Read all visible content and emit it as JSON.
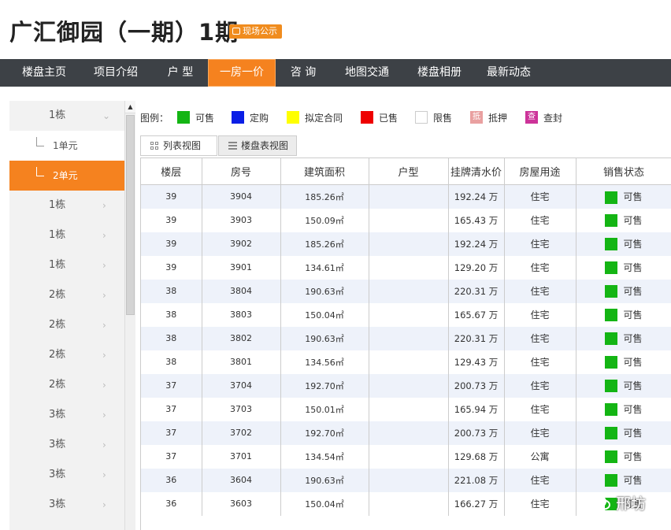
{
  "header": {
    "title": "广汇御园（一期）1期",
    "badge": "现场公示"
  },
  "nav": {
    "items": [
      {
        "label": "楼盘主页"
      },
      {
        "label": "项目介绍"
      },
      {
        "label": "户 型"
      },
      {
        "label": "一房一价",
        "active": true
      },
      {
        "label": "咨 询"
      },
      {
        "label": "地图交通"
      },
      {
        "label": "楼盘相册"
      },
      {
        "label": "最新动态"
      }
    ]
  },
  "sidebar": {
    "items": [
      {
        "label": "1栋",
        "type": "building",
        "expanded": true
      },
      {
        "label": "1单元",
        "type": "unit"
      },
      {
        "label": "2单元",
        "type": "unit",
        "active": true
      },
      {
        "label": "1栋",
        "type": "building"
      },
      {
        "label": "1栋",
        "type": "building"
      },
      {
        "label": "1栋",
        "type": "building"
      },
      {
        "label": "2栋",
        "type": "building"
      },
      {
        "label": "2栋",
        "type": "building"
      },
      {
        "label": "2栋",
        "type": "building"
      },
      {
        "label": "2栋",
        "type": "building"
      },
      {
        "label": "3栋",
        "type": "building"
      },
      {
        "label": "3栋",
        "type": "building"
      },
      {
        "label": "3栋",
        "type": "building"
      },
      {
        "label": "3栋",
        "type": "building"
      }
    ]
  },
  "legend": {
    "label": "图例：",
    "items": [
      {
        "label": "可售",
        "color": "#14b514"
      },
      {
        "label": "定购",
        "color": "#0a1ee6"
      },
      {
        "label": "拟定合同",
        "color": "#ffff00"
      },
      {
        "label": "已售",
        "color": "#ee0000"
      },
      {
        "label": "限售",
        "color": "#ffffff"
      },
      {
        "label": "抵押",
        "color": "#e9a0a0",
        "glyph": "抵"
      },
      {
        "label": "查封",
        "color": "#cc3399",
        "glyph": "查"
      }
    ]
  },
  "view_tabs": {
    "list": "列表视图",
    "table": "楼盘表视图"
  },
  "table": {
    "headers": [
      "楼层",
      "房号",
      "建筑面积",
      "户型",
      "挂牌清水价",
      "房屋用途",
      "销售状态"
    ],
    "rows": [
      {
        "floor": "39",
        "room": "3904",
        "area": "185.26㎡",
        "type": "",
        "price": "192.24 万",
        "use": "住宅",
        "status": "可售"
      },
      {
        "floor": "39",
        "room": "3903",
        "area": "150.09㎡",
        "type": "",
        "price": "165.43 万",
        "use": "住宅",
        "status": "可售"
      },
      {
        "floor": "39",
        "room": "3902",
        "area": "185.26㎡",
        "type": "",
        "price": "192.24 万",
        "use": "住宅",
        "status": "可售"
      },
      {
        "floor": "39",
        "room": "3901",
        "area": "134.61㎡",
        "type": "",
        "price": "129.20 万",
        "use": "住宅",
        "status": "可售"
      },
      {
        "floor": "38",
        "room": "3804",
        "area": "190.63㎡",
        "type": "",
        "price": "220.31 万",
        "use": "住宅",
        "status": "可售"
      },
      {
        "floor": "38",
        "room": "3803",
        "area": "150.04㎡",
        "type": "",
        "price": "165.67 万",
        "use": "住宅",
        "status": "可售"
      },
      {
        "floor": "38",
        "room": "3802",
        "area": "190.63㎡",
        "type": "",
        "price": "220.31 万",
        "use": "住宅",
        "status": "可售"
      },
      {
        "floor": "38",
        "room": "3801",
        "area": "134.56㎡",
        "type": "",
        "price": "129.43 万",
        "use": "住宅",
        "status": "可售"
      },
      {
        "floor": "37",
        "room": "3704",
        "area": "192.70㎡",
        "type": "",
        "price": "200.73 万",
        "use": "住宅",
        "status": "可售"
      },
      {
        "floor": "37",
        "room": "3703",
        "area": "150.01㎡",
        "type": "",
        "price": "165.94 万",
        "use": "住宅",
        "status": "可售"
      },
      {
        "floor": "37",
        "room": "3702",
        "area": "192.70㎡",
        "type": "",
        "price": "200.73 万",
        "use": "住宅",
        "status": "可售"
      },
      {
        "floor": "37",
        "room": "3701",
        "area": "134.54㎡",
        "type": "",
        "price": "129.68 万",
        "use": "公寓",
        "status": "可售"
      },
      {
        "floor": "36",
        "room": "3604",
        "area": "190.63㎡",
        "type": "",
        "price": "221.08 万",
        "use": "住宅",
        "status": "可售"
      },
      {
        "floor": "36",
        "room": "3603",
        "area": "150.04㎡",
        "type": "",
        "price": "166.27 万",
        "use": "住宅",
        "status": "可售"
      }
    ]
  },
  "watermark": {
    "text": "邢坊"
  }
}
